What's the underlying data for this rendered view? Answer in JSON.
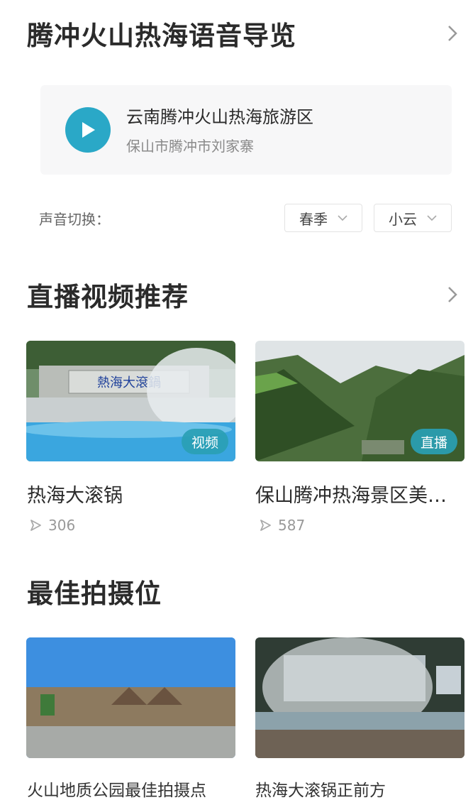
{
  "guide": {
    "title": "腾冲火山热海语音导览",
    "audio_title": "云南腾冲火山热海旅游区",
    "audio_location": "保山市腾冲市刘家寨"
  },
  "voice": {
    "label": "声音切换：",
    "season": "春季",
    "speaker": "小云"
  },
  "live": {
    "title": "直播视频推荐",
    "items": [
      {
        "title": "热海大滚锅",
        "badge": "视频",
        "plays": "306",
        "icon": "play-outline-icon"
      },
      {
        "title": "保山腾冲热海景区美…",
        "badge": "直播",
        "plays": "587",
        "icon": "play-outline-icon"
      }
    ]
  },
  "spots": {
    "title": "最佳拍摄位",
    "items": [
      {
        "title": "火山地质公园最佳拍摄点"
      },
      {
        "title": "热海大滚锅正前方"
      }
    ]
  },
  "colors": {
    "accent": "#2aa8c7",
    "badge": "#2aa0b4",
    "card_bg": "#f7f7f8"
  }
}
